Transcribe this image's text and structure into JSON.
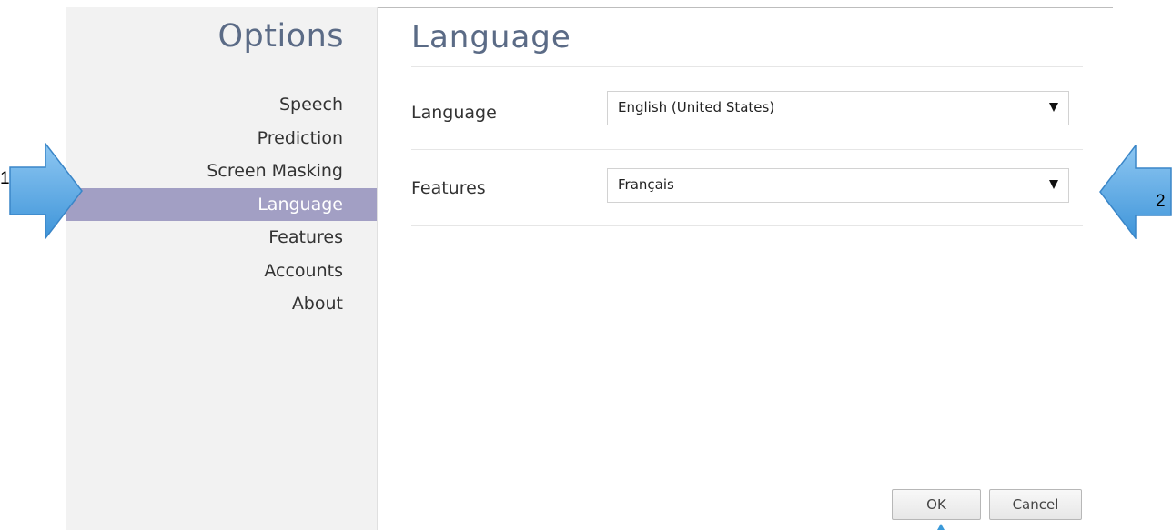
{
  "sidebar": {
    "title": "Options",
    "items": [
      {
        "label": "Speech"
      },
      {
        "label": "Prediction"
      },
      {
        "label": "Screen Masking"
      },
      {
        "label": "Language",
        "active": true
      },
      {
        "label": "Features"
      },
      {
        "label": "Accounts"
      },
      {
        "label": "About"
      }
    ]
  },
  "main": {
    "title": "Language",
    "settings": [
      {
        "label": "Language",
        "value": "English (United States)"
      },
      {
        "label": "Features",
        "value": "Français"
      }
    ]
  },
  "footer": {
    "ok_label": "OK",
    "cancel_label": "Cancel"
  },
  "annotations": [
    {
      "number": "1",
      "direction": "right"
    },
    {
      "number": "2",
      "direction": "left"
    }
  ],
  "colors": {
    "accent_selected": "#a29fc4",
    "title_text": "#5b6b86",
    "sidebar_bg": "#f2f2f2",
    "arrow_fill": "#5aa9e6"
  }
}
